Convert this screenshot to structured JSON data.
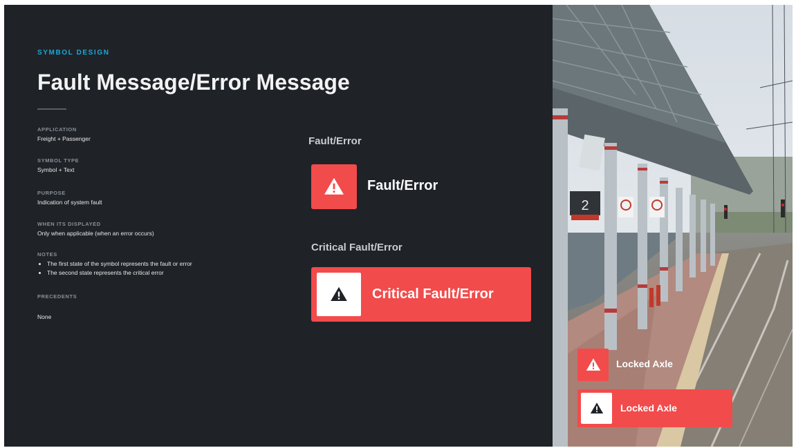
{
  "header": {
    "kicker": "SYMBOL DESIGN",
    "title": "Fault Message/Error Message"
  },
  "details": {
    "application": {
      "label": "APPLICATION",
      "value": "Freight + Passenger"
    },
    "symbol_type": {
      "label": "SYMBOL TYPE",
      "value": "Symbol + Text"
    },
    "purpose": {
      "label": "PURPOSE",
      "value": "Indication of system fault"
    },
    "when_displayed": {
      "label": "WHEN ITS DISPLAYED",
      "value": "Only when applicable (when an error occurs)"
    },
    "notes": {
      "label": "NOTES",
      "items": [
        "The first state of the symbol represents the fault or error",
        "The second state represents the critical error"
      ]
    },
    "precedents": {
      "label": "PRECEDENTS",
      "value": "None"
    }
  },
  "demo": {
    "fault": {
      "heading": "Fault/Error",
      "label": "Fault/Error",
      "icon": "warning-triangle-icon"
    },
    "critical": {
      "heading": "Critical Fault/Error",
      "label": "Critical Fault/Error",
      "icon": "warning-triangle-icon"
    }
  },
  "photo": {
    "platform_number": "2",
    "overlay": {
      "fault_label": "Locked Axle",
      "critical_label": "Locked Axle"
    }
  },
  "colors": {
    "background": "#1f2328",
    "accent": "#1ea7d6",
    "fault_red": "#f24b4b",
    "icon_dark": "#1f2328"
  }
}
